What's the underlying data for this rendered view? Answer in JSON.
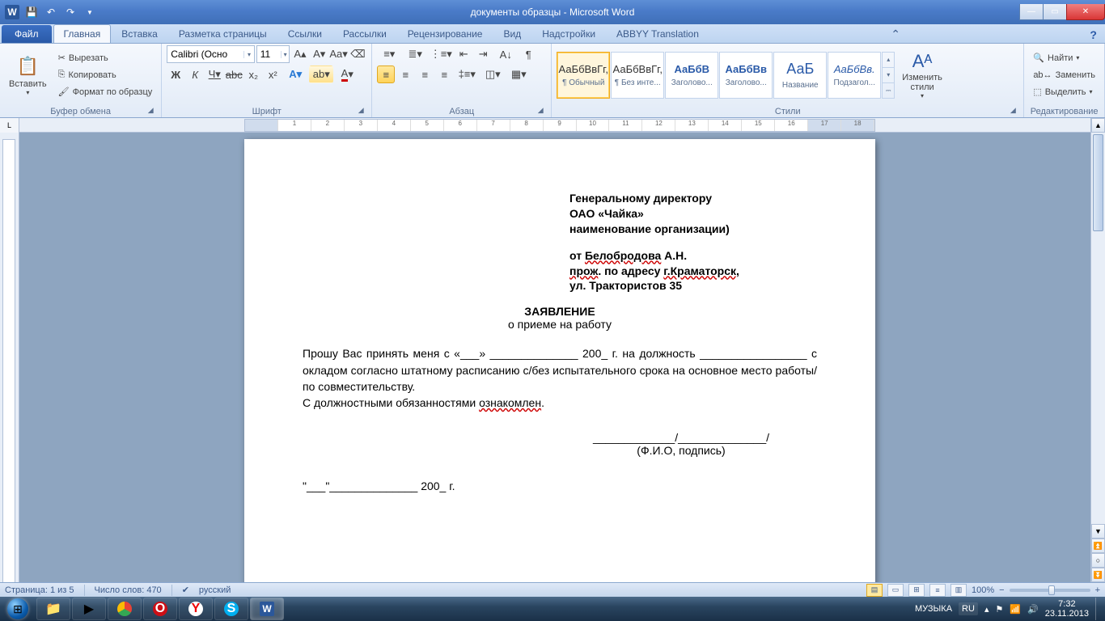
{
  "window": {
    "title": "документы образцы - Microsoft Word",
    "app_letter": "W"
  },
  "tabs": {
    "file": "Файл",
    "items": [
      "Главная",
      "Вставка",
      "Разметка страницы",
      "Ссылки",
      "Рассылки",
      "Рецензирование",
      "Вид",
      "Надстройки",
      "ABBYY Translation"
    ],
    "active_index": 0
  },
  "ribbon": {
    "clipboard": {
      "paste": "Вставить",
      "cut": "Вырезать",
      "copy": "Копировать",
      "format_painter": "Формат по образцу",
      "group": "Буфер обмена"
    },
    "font": {
      "family": "Calibri (Осно",
      "size": "11",
      "group": "Шрифт"
    },
    "paragraph": {
      "group": "Абзац"
    },
    "styles": {
      "group": "Стили",
      "change": "Изменить\nстили",
      "items": [
        {
          "preview": "АаБбВвГг,",
          "name": "¶ Обычный"
        },
        {
          "preview": "АаБбВвГг,",
          "name": "¶ Без инте..."
        },
        {
          "preview": "АаБбВ",
          "name": "Заголово..."
        },
        {
          "preview": "АаБбВв",
          "name": "Заголово..."
        },
        {
          "preview": "АаБ",
          "name": "Название"
        },
        {
          "preview": "АаБбВв.",
          "name": "Подзагол..."
        }
      ]
    },
    "editing": {
      "group": "Редактирование",
      "find": "Найти",
      "replace": "Заменить",
      "select": "Выделить"
    }
  },
  "document": {
    "hdr1": "Генеральному директору",
    "hdr2": "ОАО «Чайка»",
    "hdr3": "наименование организации)",
    "hdr4a": "от ",
    "hdr4b": "Белобродова",
    "hdr4c": " А.Н.",
    "hdr5a": "прож",
    "hdr5b": ". по адресу ",
    "hdr5c": "г.Краматорск,",
    "hdr6": "ул. Трактористов 35",
    "title": "ЗАЯВЛЕНИЕ",
    "subtitle": "о приеме на работу",
    "body1": "Прошу Вас принять меня с «___» ______________ 200_ г. на должность _________________ с окладом согласно штатному расписанию с/без испытательного срока на основное место работы/по совместительству.",
    "body2a": "С должностными обязанностями ",
    "body2b": "ознакомлен",
    "sig": "_____________/______________/",
    "sig2": "(Ф.И.О, подпись)",
    "date": "\"___\"______________ 200_ г."
  },
  "status": {
    "page": "Страница: 1 из 5",
    "words": "Число слов: 470",
    "lang": "русский",
    "zoom": "100%"
  },
  "taskbar": {
    "media": "МУЗЫКА",
    "lang": "RU",
    "time": "7:32",
    "date": "23.11.2013"
  }
}
